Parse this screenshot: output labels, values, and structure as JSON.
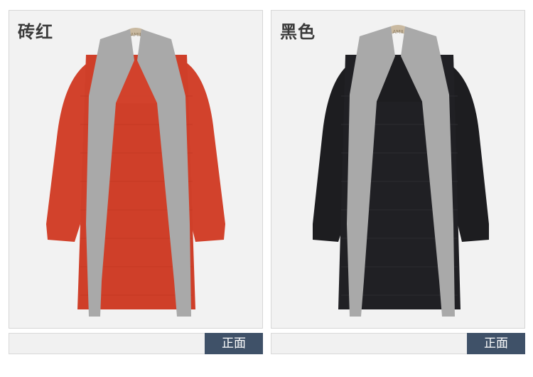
{
  "variants": [
    {
      "color_name": "砖红",
      "view_label": "正面",
      "body_color": "#d2422c",
      "trim_color": "#a9a9a9"
    },
    {
      "color_name": "黑色",
      "view_label": "正面",
      "body_color": "#1d1d20",
      "trim_color": "#a9a9a9"
    }
  ],
  "hanger_label": "AMII"
}
